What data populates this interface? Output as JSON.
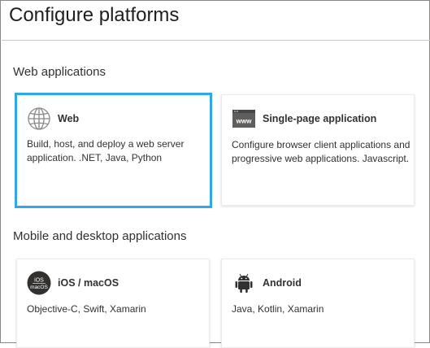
{
  "page": {
    "title": "Configure platforms"
  },
  "sections": {
    "web_applications": "Web applications",
    "mobile_desktop": "Mobile and desktop applications"
  },
  "cards": {
    "web": {
      "title": "Web",
      "description": "Build, host, and deploy a web server application. .NET, Java, Python",
      "icon": "globe-icon",
      "selected": true
    },
    "spa": {
      "title": "Single-page application",
      "description": "Configure browser client applications and progressive web applications. Javascript.",
      "icon": "www-icon",
      "icon_text": "www"
    },
    "ios": {
      "title": "iOS / macOS",
      "description": "Objective-C, Swift, Xamarin",
      "icon": "ios-macos-icon",
      "icon_text_top": "iOS",
      "icon_text_bottom": "macOS"
    },
    "android": {
      "title": "Android",
      "description": "Java, Kotlin, Xamarin",
      "icon": "android-icon"
    }
  },
  "colors": {
    "selected_border": "#2ea8e6",
    "text": "#323130"
  }
}
